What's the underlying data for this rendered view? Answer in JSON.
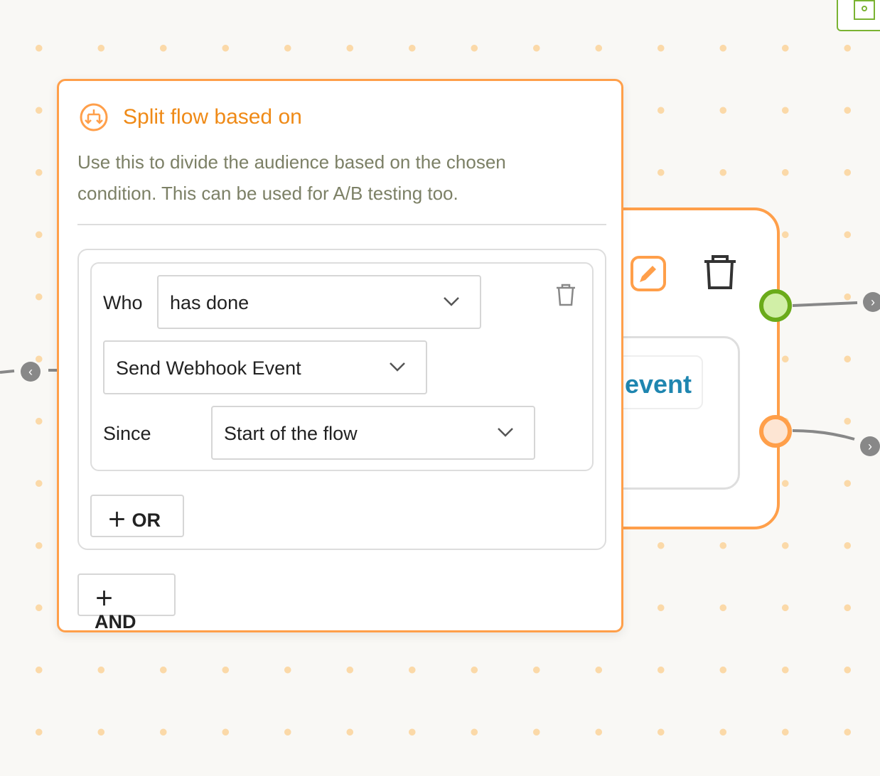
{
  "panel": {
    "title": "Split flow based on",
    "description": "Use this to divide the audience based on the chosen condition. This can be used for A/B testing too.",
    "condition": {
      "who_label": "Who",
      "who_value": "has done",
      "event_value": "Send Webhook Event",
      "since_label": "Since",
      "since_value": "Start of the flow"
    },
    "or_label": "OR",
    "and_label": "AND"
  },
  "node": {
    "chip_text": "event"
  },
  "colors": {
    "accent": "#ff9f4a",
    "title": "#ef8a17",
    "yes_port": "#6aab1a",
    "no_port": "#ff9f4a",
    "chip_text": "#1f86b0"
  }
}
